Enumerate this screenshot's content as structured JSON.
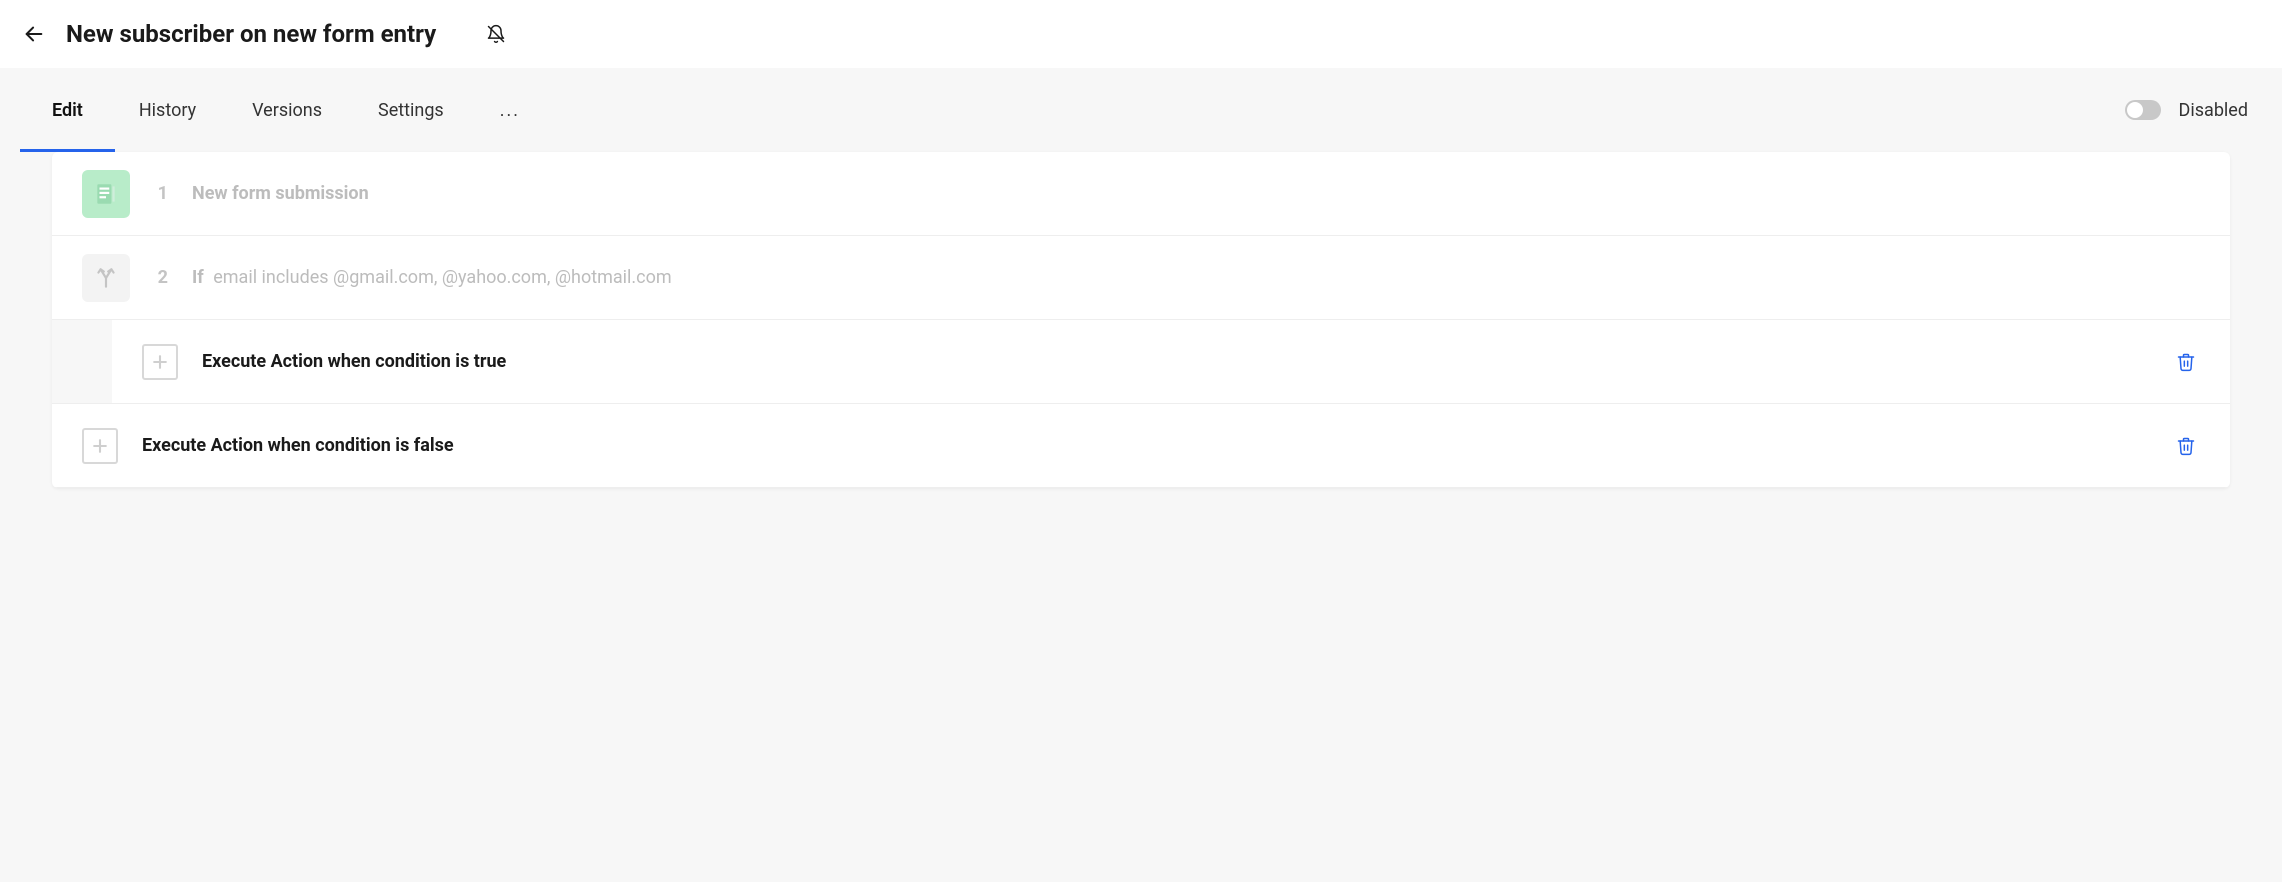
{
  "header": {
    "title": "New subscriber on new form entry"
  },
  "tabs": {
    "items": [
      "Edit",
      "History",
      "Versions",
      "Settings"
    ],
    "more": "...",
    "active_index": 0
  },
  "toggle": {
    "label": "Disabled",
    "on": false
  },
  "steps": [
    {
      "num": "1",
      "icon": "form-icon",
      "label": "New form submission"
    },
    {
      "num": "2",
      "icon": "branch-icon",
      "if_word": "If",
      "condition": "email includes @gmail.com, @yahoo.com, @hotmail.com"
    }
  ],
  "branches": {
    "true_label": "Execute Action when condition is true",
    "false_label": "Execute Action when condition is false"
  }
}
